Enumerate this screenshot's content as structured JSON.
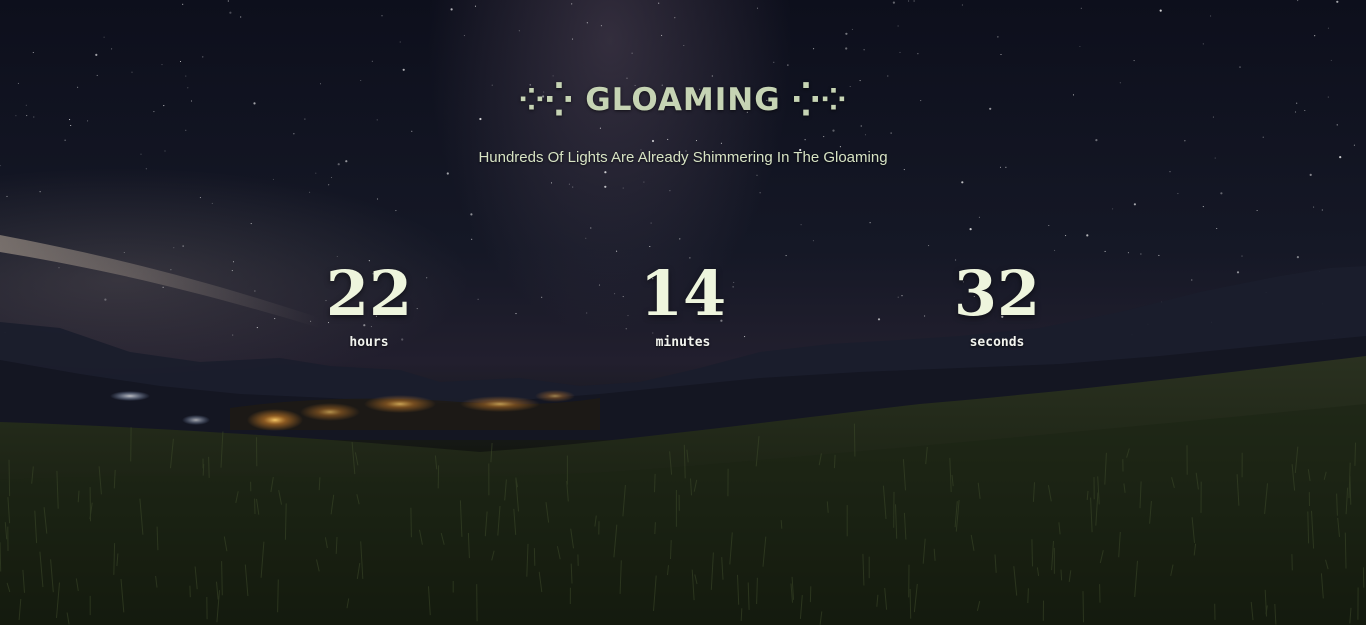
{
  "header": {
    "title": "⁘⁛ GLOAMING ⁛⁘",
    "subtitle": "Hundreds Of Lights Are Already Shimmering In The Gloaming"
  },
  "countdown": {
    "hours": {
      "value": "22",
      "label": "hours"
    },
    "minutes": {
      "value": "14",
      "label": "minutes"
    },
    "seconds": {
      "value": "32",
      "label": "seconds"
    }
  },
  "colors": {
    "title": "#c6d4b4",
    "subtitle": "#d7e3c4",
    "digits": "#eef5dd",
    "labels": "#f2f4ee",
    "sky_top": "#0d0f1c",
    "grass": "#10140c"
  }
}
